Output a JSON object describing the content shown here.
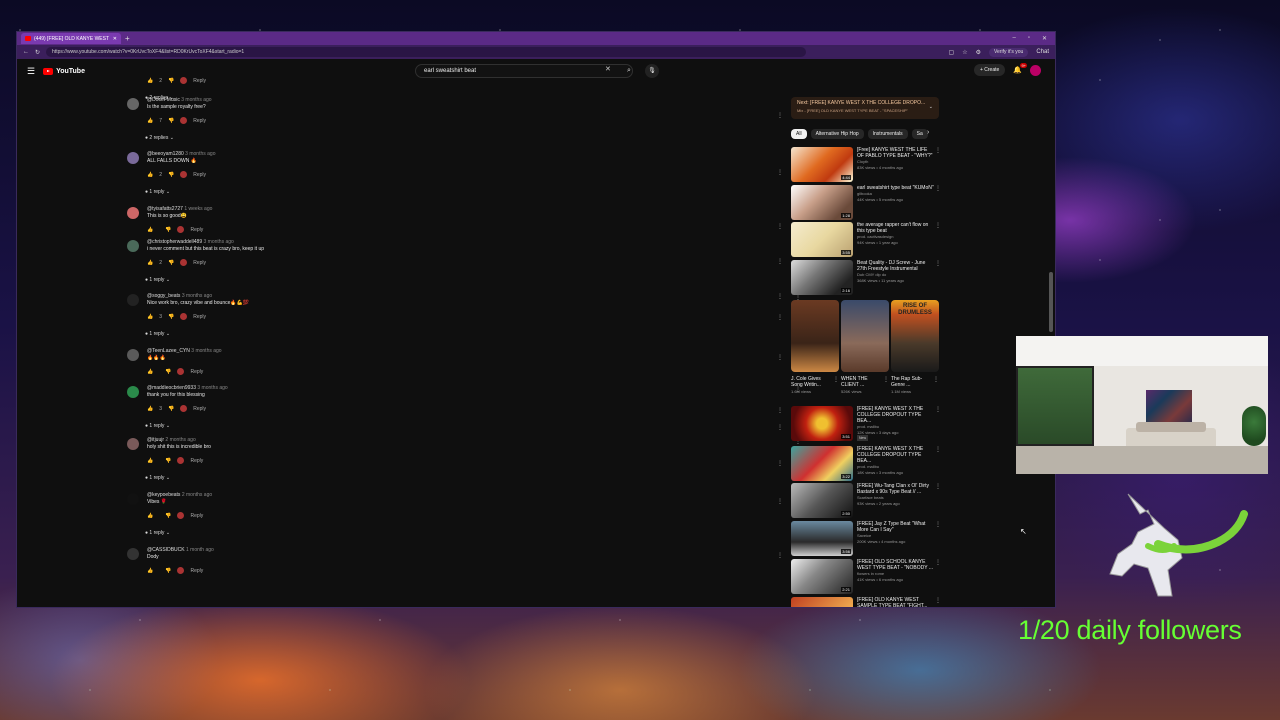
{
  "browser": {
    "tab_title": "(449) [FREE] OLD KANYE WEST",
    "new_tab": "+",
    "url": "https://www.youtube.com/watch?v=0KrUvcToXF4&list=RD0KrUvcToXF4&start_radio=1",
    "verify_label": "Verify it's you",
    "chat_label": "Chat"
  },
  "youtube": {
    "logo": "YouTube",
    "search_value": "earl sweatshirt beat",
    "create_label": "Create",
    "notif_count": "9+"
  },
  "comments": [
    {
      "user": "",
      "ago": "",
      "text": "",
      "likes": "2",
      "replies": "2 replies",
      "partial": true
    },
    {
      "user": "@DoseFMusic",
      "verified": true,
      "ago": "3 months ago",
      "text": "Is the sample royalty free?",
      "likes": "7",
      "replies": "2 replies"
    },
    {
      "user": "@beeoyam1280",
      "ago": "3 months ago",
      "text": "ALL FALLS DOWN 🔥",
      "likes": "2",
      "replies": "1 reply"
    },
    {
      "user": "@tyisafatts2727",
      "ago": "1 weeks ago",
      "text": "This is so good😩",
      "likes": "",
      "replies": ""
    },
    {
      "user": "@christopherwaddell489",
      "ago": "3 months ago",
      "text": "i never comment but this beat is crazy bro, keep it up",
      "likes": "2",
      "replies": "1 reply"
    },
    {
      "user": "@soggy_beats",
      "ago": "3 months ago",
      "text": "Nice work bro, crazy vibe and bounce🔥💪💯",
      "likes": "3",
      "replies": "1 reply"
    },
    {
      "user": "@TeenLazee_CYN",
      "ago": "3 months ago",
      "text": "🔥🔥🔥",
      "likes": "",
      "replies": ""
    },
    {
      "user": "@maddieocbrien9933",
      "ago": "3 months ago",
      "text": "thank you for this blessing",
      "likes": "3",
      "replies": "1 reply"
    },
    {
      "user": "@itjuujr",
      "ago": "2 months ago",
      "text": "holy shit this is incredible bro",
      "likes": "",
      "replies": "1 reply"
    },
    {
      "user": "@keypoebeats",
      "ago": "2 months ago",
      "text": "Vibes 🌹",
      "likes": "",
      "replies": "1 reply"
    },
    {
      "user": "@CASSIDBUCK",
      "verified": true,
      "ago": "1 month ago",
      "text": "Dody",
      "likes": "",
      "replies": ""
    }
  ],
  "reply_label": "Reply",
  "sidebar": {
    "next_title": "Next: [FREE] KANYE WEST X THE COLLEGE DROPO...",
    "next_sub": "Mix - [FREE] OLD KANYE WEST TYPE BEAT - \"SPACESHIP\"",
    "chips": [
      "All",
      "Alternative Hip Hop",
      "Instrumentals",
      "Sa"
    ],
    "videos_top": [
      {
        "title": "[Free] KANYE WEST THE LIFE OF PABLO TYPE BEAT - \"WHY?\"",
        "channel": "Cloyth",
        "meta": "83K views • 4 months ago",
        "duration": "4:44"
      },
      {
        "title": "earl sweatshirt type beat \"KUMoN\"",
        "channel": "gilbooka",
        "meta": "44K views • 5 months ago",
        "duration": "1:28"
      },
      {
        "title": "the average rapper can't flow on this type beat",
        "channel": "prod. cactivasdesign",
        "meta": "94K views • 1 year ago",
        "duration": "3:55"
      },
      {
        "title": "Beat Quality - DJ Screw - June 27th Freestyle Instrumental",
        "channel": "Dub CMY dip do",
        "meta": "368K views • 11 years ago",
        "duration": "2:16"
      }
    ],
    "shorts": [
      {
        "title": "J. Cole Gives Song Writin...",
        "views": "1.6M views"
      },
      {
        "title": "WHEN THE CLIENT ...",
        "views": "526K views"
      },
      {
        "title": "The Rap Sub-Genre ...",
        "views": "1.1M views"
      }
    ],
    "shorts_overlay_text": "RISE OF DRUMLESS",
    "videos_bottom": [
      {
        "title": "[FREE] KANYE WEST X THE COLLEGE DROPOUT TYPE BEA...",
        "channel": "prod. malibu",
        "meta": "12K views • 3 days ago",
        "duration": "3:51",
        "badge": "New"
      },
      {
        "title": "[FREE] KANYE WEST X THE COLLEGE DROPOUT TYPE BEA...",
        "channel": "prod. malibu",
        "meta": "18K views • 3 months ago",
        "duration": "3:22"
      },
      {
        "title": "[FREE] Wu-Tang Clan x Ol' Dirty Bastard x 90s Type Beat // ...",
        "channel": "Scarface beats",
        "meta": "93K views • 2 years ago",
        "duration": "2:50"
      },
      {
        "title": "[FREE] Jay Z Type Beat \"What More Can I Say\"",
        "channel": "Saveice",
        "meta": "200K views • 4 months ago",
        "duration": "3:56"
      },
      {
        "title": "[FREE] OLD SCHOOL KANYE WEST TYPE BEAT - \"NOBODY ...",
        "channel": "flowers in rome",
        "meta": "41K views • 6 months ago",
        "duration": "2:21"
      },
      {
        "title": "[FREE] OLD KANYE WEST SAMPLE TYPE BEAT \"FIGHT...",
        "channel": "",
        "meta": "",
        "duration": ""
      }
    ]
  },
  "overlay": {
    "followers_text": "1/20 daily followers"
  },
  "colors": {
    "yt_bg": "#0f0f0f",
    "browser_frame": "#5b2a86",
    "followers_green": "#66ff33",
    "yt_red": "#ff0000"
  }
}
